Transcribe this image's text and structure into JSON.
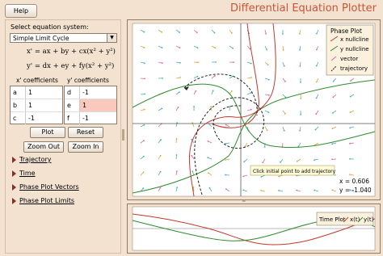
{
  "toolbar": {
    "help_label": "Help"
  },
  "app": {
    "title": "Differential Equation Plotter"
  },
  "left": {
    "select_label": "Select equation system:",
    "system_selected": "Simple Limit Cycle",
    "equation_x": "x' = ax + by + cx(x² + y²)",
    "equation_y": "y' = dx + ey + fy(x² + y²)",
    "x_coef_title": "x' coefficients",
    "y_coef_title": "y' coefficients",
    "x_coefs": [
      {
        "name": "a",
        "value": "1"
      },
      {
        "name": "b",
        "value": "1"
      },
      {
        "name": "c",
        "value": "-1"
      }
    ],
    "y_coefs": [
      {
        "name": "d",
        "value": "-1"
      },
      {
        "name": "e",
        "value": "1"
      },
      {
        "name": "f",
        "value": "-1"
      }
    ],
    "buttons": {
      "plot": "Plot",
      "reset": "Reset",
      "zoom_out": "Zoom Out",
      "zoom_in": "Zoom In"
    },
    "expanders": [
      "Trajectory",
      "Time",
      "Phase Plot Vectors",
      "Phase Plot Limits"
    ]
  },
  "phase": {
    "legend_title": "Phase Plot",
    "legend_items": [
      "x nullcline",
      "y nullcline",
      "vector",
      "trajectory"
    ],
    "tooltip": "Click initial point to add trajectory",
    "coord_x": "x = 0.606",
    "coord_y": "y = -1.040"
  },
  "time": {
    "legend_title": "Time Plot",
    "legend_items": [
      "x(t)",
      "y(t)"
    ]
  },
  "colors": {
    "x_nullcline": "#c0392b",
    "y_nullcline": "#2e8b2e",
    "trajectory": "#222222",
    "vectors": [
      "#4fa3d9",
      "#d96aa0",
      "#3fb59d",
      "#e0a03a"
    ],
    "title": "#c8553a"
  }
}
